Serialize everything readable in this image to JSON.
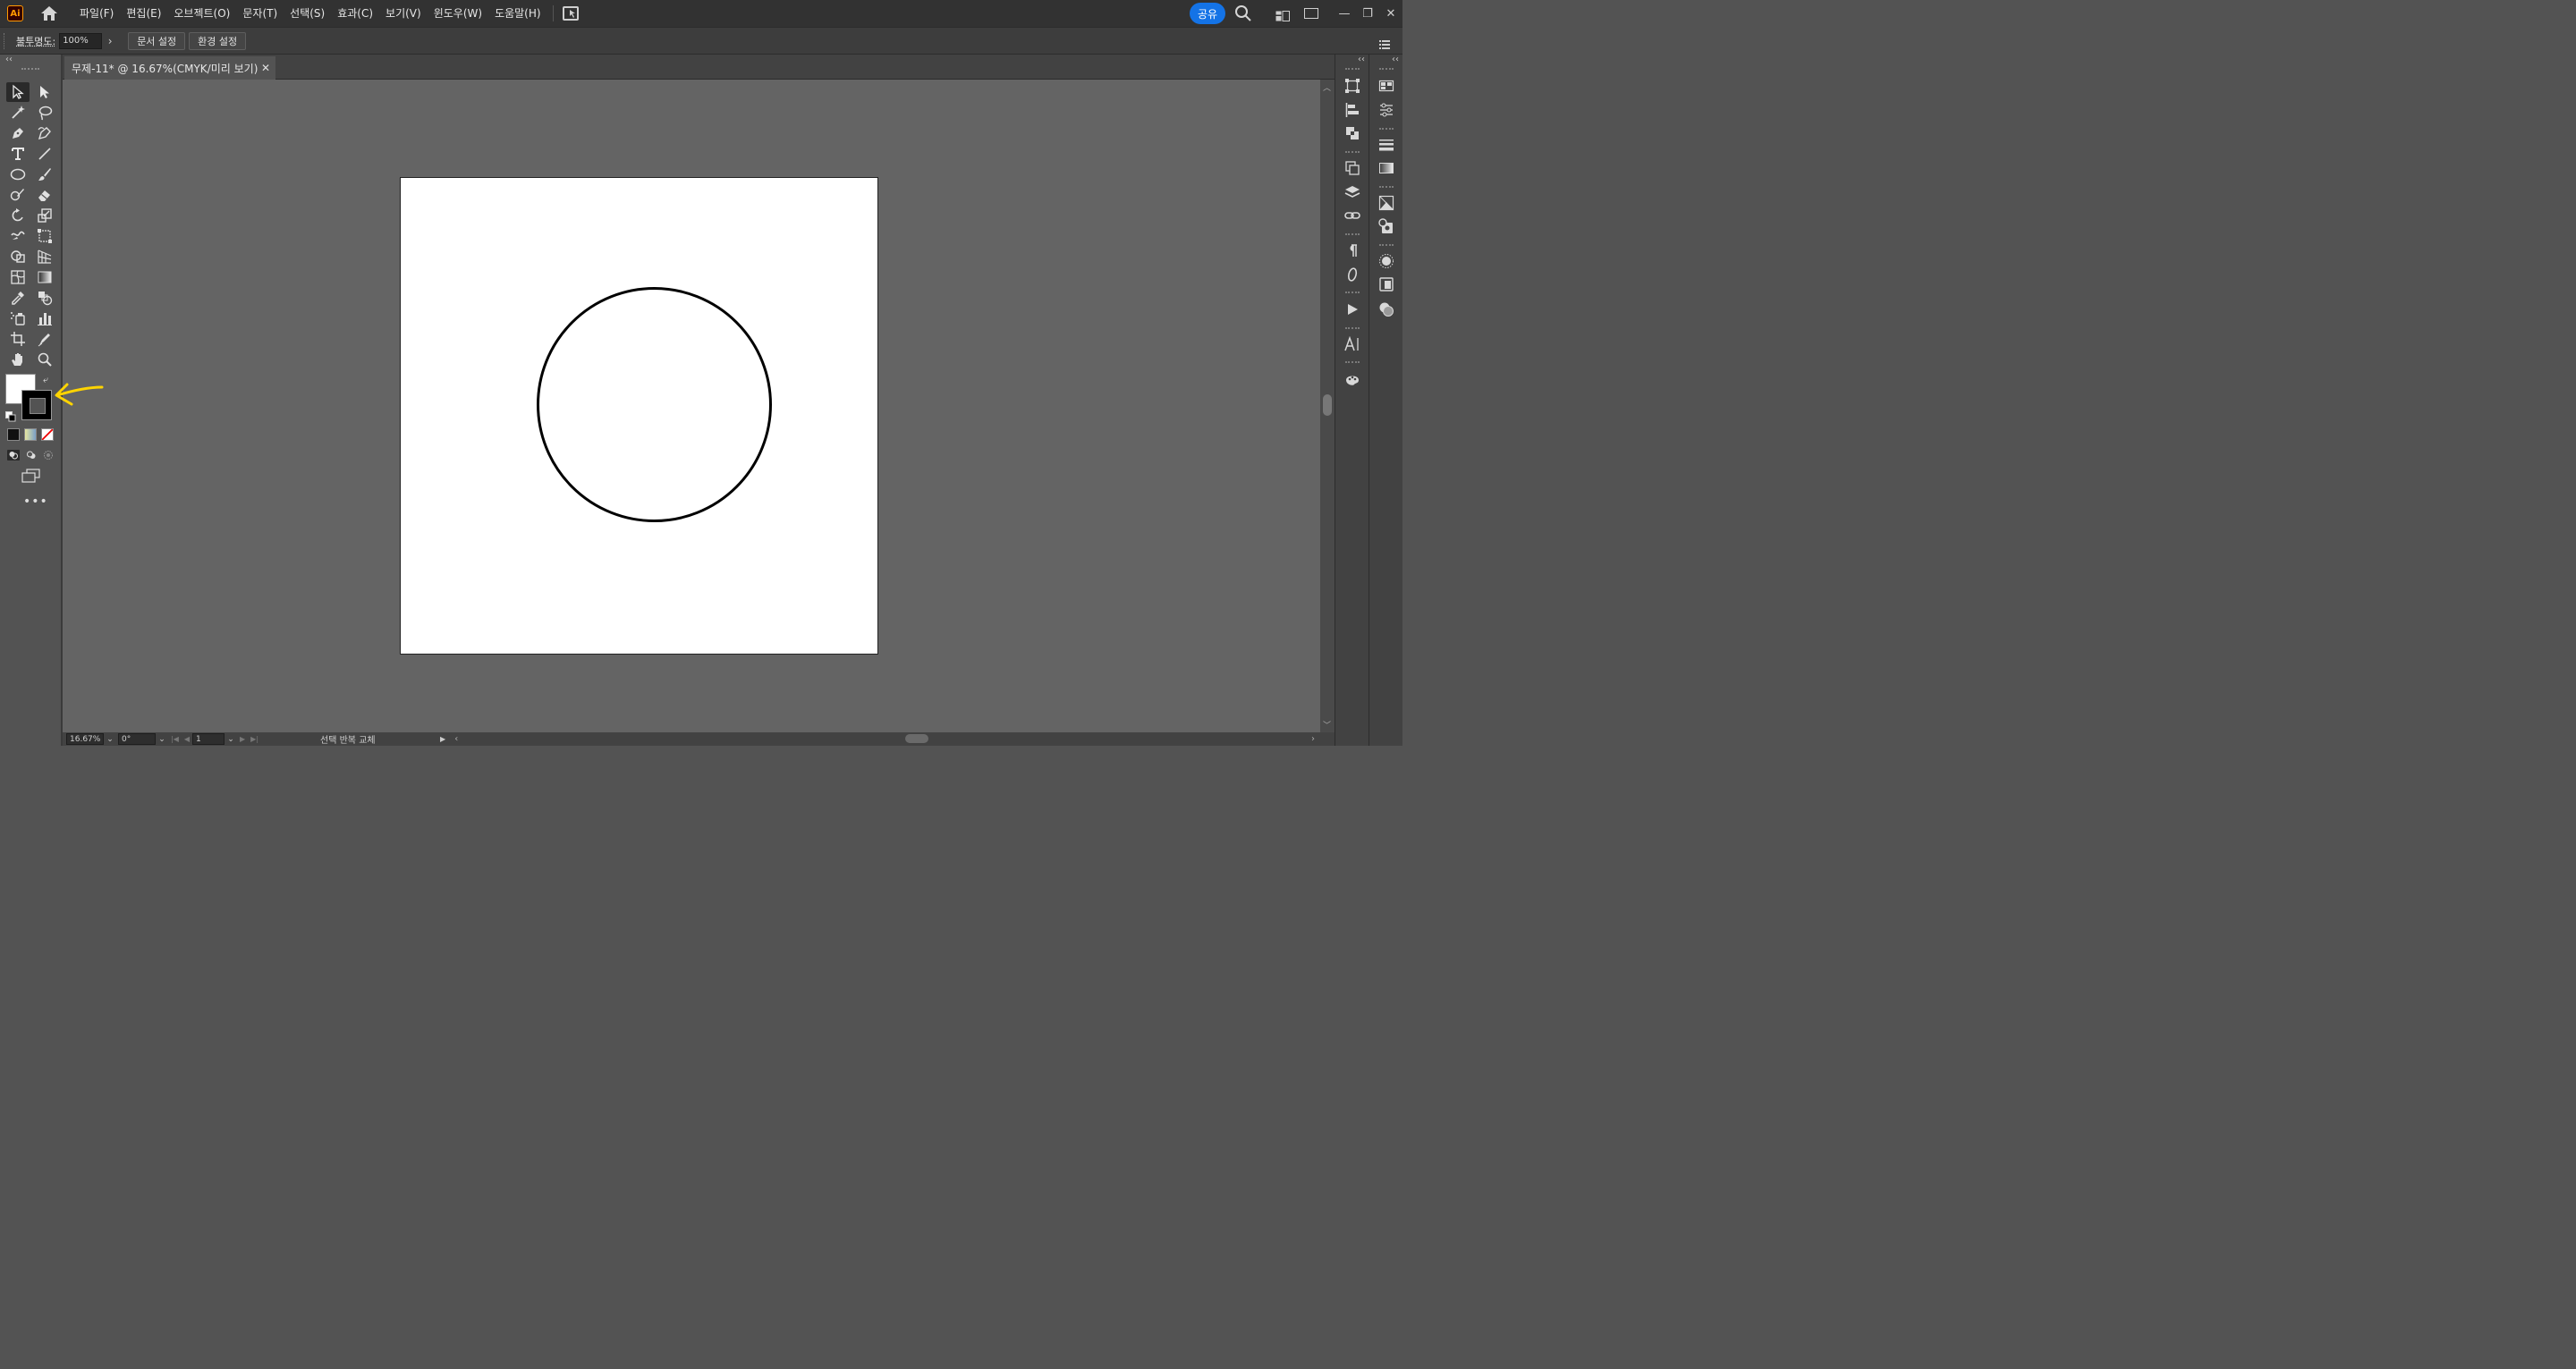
{
  "app": {
    "logo_text": "Ai",
    "menu": [
      "파일(F)",
      "편집(E)",
      "오브젝트(O)",
      "문자(T)",
      "선택(S)",
      "효과(C)",
      "보기(V)",
      "윈도우(W)",
      "도움말(H)"
    ],
    "share_label": "공유",
    "window_buttons": [
      "—",
      "❐",
      "✕"
    ]
  },
  "control_bar": {
    "opacity_label": "불투명도:",
    "opacity_value": "100%",
    "doc_setup_label": "문서 설정",
    "preferences_label": "환경 설정"
  },
  "document": {
    "tab_title": "무제-11* @ 16.67%(CMYK/미리 보기)",
    "close_glyph": "✕"
  },
  "status_bar": {
    "zoom": "16.67%",
    "rotation": "0°",
    "artboard_number": "1",
    "status_text": "선택 반복 교체"
  },
  "colors": {
    "fill": "#ffffff",
    "stroke": "#000000",
    "accent": "#1473e6",
    "annotation": "#ffd400"
  },
  "icons": {
    "toolbar": [
      "selection-tool-icon",
      "direct-selection-tool-icon",
      "magic-wand-tool-icon",
      "lasso-tool-icon",
      "pen-tool-icon",
      "curvature-tool-icon",
      "type-tool-icon",
      "line-segment-tool-icon",
      "ellipse-tool-icon",
      "paintbrush-tool-icon",
      "shaper-tool-icon",
      "eraser-tool-icon",
      "rotate-tool-icon",
      "scale-tool-icon",
      "warp-tool-icon",
      "free-transform-tool-icon",
      "shape-builder-tool-icon",
      "perspective-grid-tool-icon",
      "mesh-tool-icon",
      "gradient-tool-icon",
      "eyedropper-tool-icon",
      "blend-tool-icon",
      "symbol-sprayer-tool-icon",
      "column-graph-tool-icon",
      "artboard-tool-icon",
      "slice-tool-icon",
      "hand-tool-icon",
      "zoom-tool-icon"
    ],
    "right_panels": [
      "transform-panel-icon",
      "align-panel-icon",
      "pathfinder-panel-icon",
      "artboards-panel-icon",
      "layers-panel-icon",
      "links-panel-icon",
      "paragraph-panel-icon",
      "glyphs-panel-icon",
      "actions-panel-icon",
      "character-panel-icon",
      "color-guide-panel-icon",
      "swatches-panel-icon",
      "properties-panel-icon",
      "stroke-panel-icon",
      "gradient-panel-icon",
      "image-trace-panel-icon",
      "symbols-panel-icon",
      "brushes-panel-icon",
      "graphic-styles-panel-icon",
      "appearance-panel-icon",
      "transparency-panel-icon"
    ]
  }
}
